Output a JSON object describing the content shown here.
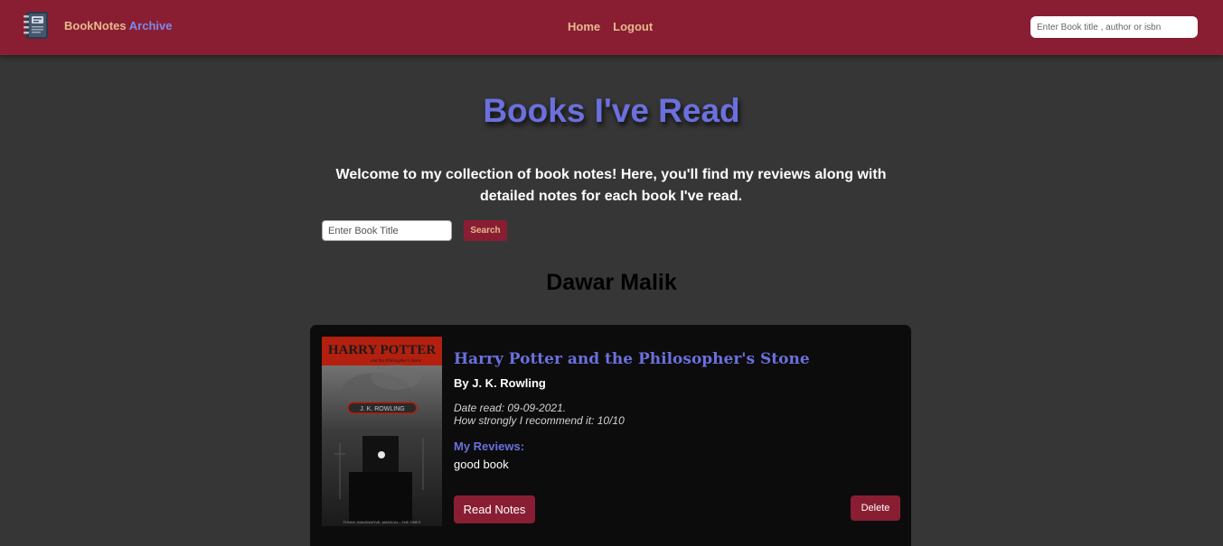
{
  "colors": {
    "navbar_bg": "#891e33",
    "page_bg": "#363636",
    "accent_blue": "#6b70dd",
    "brand_tan": "#e6b98d",
    "card_bg": "#0c0c0c",
    "button_bg": "#891e33"
  },
  "navbar": {
    "logo_icon": "notebook-icon",
    "brand_first": "BookNotes",
    "brand_second": "Archive",
    "links": [
      {
        "label": "Home"
      },
      {
        "label": "Logout"
      }
    ],
    "search_placeholder": "Enter Book title , author or isbn"
  },
  "main": {
    "title": "Books I've Read",
    "intro": "Welcome to my collection of book notes! Here, you'll find my reviews along with detailed notes for each book I've read.",
    "search_placeholder": "Enter Book Title",
    "search_button": "Search",
    "author_name": "Dawar Malik"
  },
  "books": [
    {
      "cover": {
        "top_text": "HARRY POTTER",
        "sub_text": "and the Philosopher's Stone",
        "author_band": "J. K. ROWLING",
        "bottom_text": "FUNNY, IMAGINATIVE, MAGICAL - THE TIMES"
      },
      "title": "Harry Potter and the Philosopher's Stone",
      "author_line": "By J. K. Rowling",
      "date_read": "Date read: 09-09-2021.",
      "recommend": "How strongly I recommend it: 10/10",
      "reviews_label": "My Reviews:",
      "review": "good book",
      "read_notes_label": "Read Notes",
      "delete_label": "Delete"
    }
  ]
}
